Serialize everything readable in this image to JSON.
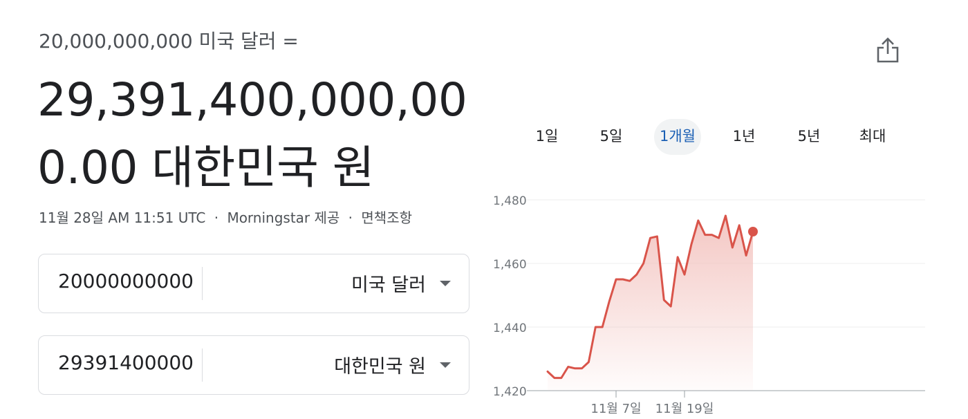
{
  "converter": {
    "input_label": "20,000,000,000 미국 달러 =",
    "result_line1": "29,391,400,000,00",
    "result_line2": "0.00 대한민국 원",
    "timestamp": "11월 28일 AM 11:51 UTC",
    "source": "Morningstar 제공",
    "disclaimer": "면책조항",
    "separator": "·",
    "from": {
      "amount": "20000000000",
      "currency": "미국 달러"
    },
    "to": {
      "amount": "29391400000",
      "currency": "대한민국 원"
    }
  },
  "icons": {
    "share": "share-icon",
    "dropdown": "caret-down-icon"
  },
  "tabs": [
    {
      "label": "1일",
      "active": false
    },
    {
      "label": "5일",
      "active": false
    },
    {
      "label": "1개월",
      "active": true
    },
    {
      "label": "1년",
      "active": false
    },
    {
      "label": "5년",
      "active": false
    },
    {
      "label": "최대",
      "active": false
    }
  ],
  "colors": {
    "line": "#d9544a",
    "fill_top": "#f3c4c0",
    "accent": "#1a5fb4"
  },
  "chart_data": {
    "type": "area",
    "y_ticks": [
      "1,420",
      "1,440",
      "1,460",
      "1,480"
    ],
    "ylim": [
      1420,
      1480
    ],
    "x_ticks": [
      {
        "label": "11월 7일",
        "index": 10
      },
      {
        "label": "11월 19일",
        "index": 20
      }
    ],
    "grid": true,
    "values": [
      1426,
      1424,
      1424,
      1427.5,
      1427,
      1427,
      1429,
      1440,
      1440,
      1448,
      1455,
      1455,
      1454.5,
      1456.5,
      1460,
      1468,
      1468.5,
      1448.5,
      1446.5,
      1462,
      1456.5,
      1466,
      1473.5,
      1469,
      1469,
      1468,
      1475,
      1465,
      1472,
      1462.5,
      1470
    ]
  }
}
